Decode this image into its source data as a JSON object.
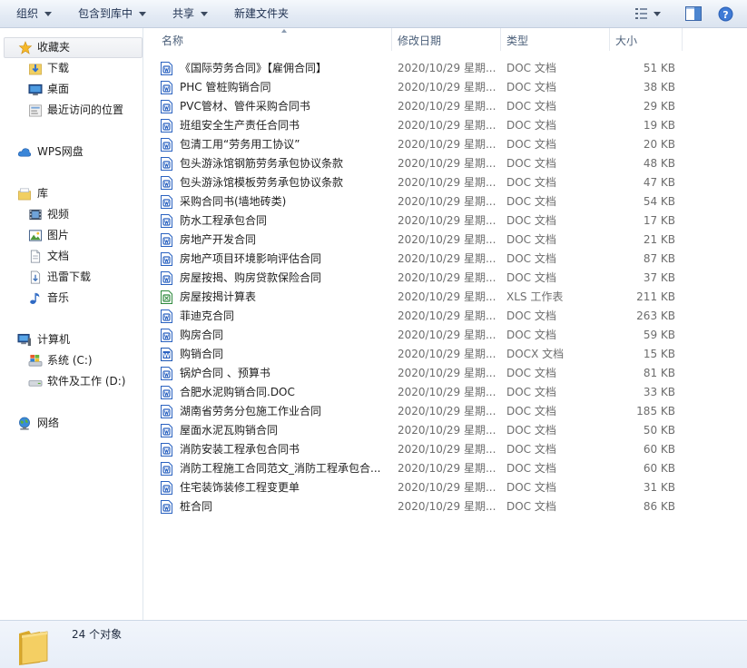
{
  "toolbar": {
    "organize": "组织",
    "include_library": "包含到库中",
    "share": "共享",
    "new_folder": "新建文件夹"
  },
  "nav": {
    "favorites": "收藏夹",
    "downloads": "下载",
    "desktop": "桌面",
    "recent": "最近访问的位置",
    "wps": "WPS网盘",
    "libraries": "库",
    "videos": "视频",
    "pictures": "图片",
    "documents": "文档",
    "xunlei": "迅雷下载",
    "music": "音乐",
    "computer": "计算机",
    "drive_c": "系统 (C:)",
    "drive_d": "软件及工作 (D:)",
    "network": "网络"
  },
  "columns": {
    "name": "名称",
    "date": "修改日期",
    "type": "类型",
    "size": "大小"
  },
  "files": [
    {
      "name": "《国际劳务合同》【雇佣合同】",
      "date": "2020/10/29 星期...",
      "type": "DOC 文档",
      "size": "51 KB",
      "icon": "doc"
    },
    {
      "name": "PHC 管桩购销合同",
      "date": "2020/10/29 星期...",
      "type": "DOC 文档",
      "size": "38 KB",
      "icon": "doc"
    },
    {
      "name": "PVC管材、管件采购合同书",
      "date": "2020/10/29 星期...",
      "type": "DOC 文档",
      "size": "29 KB",
      "icon": "doc"
    },
    {
      "name": "班组安全生产责任合同书",
      "date": "2020/10/29 星期...",
      "type": "DOC 文档",
      "size": "19 KB",
      "icon": "doc"
    },
    {
      "name": "包清工用“劳务用工协议”",
      "date": "2020/10/29 星期...",
      "type": "DOC 文档",
      "size": "20 KB",
      "icon": "doc"
    },
    {
      "name": "包头游泳馆钢筋劳务承包协议条款",
      "date": "2020/10/29 星期...",
      "type": "DOC 文档",
      "size": "48 KB",
      "icon": "doc"
    },
    {
      "name": "包头游泳馆模板劳务承包协议条款",
      "date": "2020/10/29 星期...",
      "type": "DOC 文档",
      "size": "47 KB",
      "icon": "doc"
    },
    {
      "name": "采购合同书(墙地砖类)",
      "date": "2020/10/29 星期...",
      "type": "DOC 文档",
      "size": "54 KB",
      "icon": "doc"
    },
    {
      "name": "防水工程承包合同",
      "date": "2020/10/29 星期...",
      "type": "DOC 文档",
      "size": "17 KB",
      "icon": "doc"
    },
    {
      "name": "房地产开发合同",
      "date": "2020/10/29 星期...",
      "type": "DOC 文档",
      "size": "21 KB",
      "icon": "doc"
    },
    {
      "name": "房地产项目环境影响评估合同",
      "date": "2020/10/29 星期...",
      "type": "DOC 文档",
      "size": "87 KB",
      "icon": "doc"
    },
    {
      "name": "房屋按揭、购房贷款保险合同",
      "date": "2020/10/29 星期...",
      "type": "DOC 文档",
      "size": "37 KB",
      "icon": "doc"
    },
    {
      "name": "房屋按揭计算表",
      "date": "2020/10/29 星期...",
      "type": "XLS 工作表",
      "size": "211 KB",
      "icon": "xls"
    },
    {
      "name": "菲迪克合同",
      "date": "2020/10/29 星期...",
      "type": "DOC 文档",
      "size": "263 KB",
      "icon": "doc"
    },
    {
      "name": "购房合同",
      "date": "2020/10/29 星期...",
      "type": "DOC 文档",
      "size": "59 KB",
      "icon": "doc"
    },
    {
      "name": "购销合同",
      "date": "2020/10/29 星期...",
      "type": "DOCX 文档",
      "size": "15 KB",
      "icon": "docx"
    },
    {
      "name": "锅炉合同 、预算书",
      "date": "2020/10/29 星期...",
      "type": "DOC 文档",
      "size": "81 KB",
      "icon": "doc"
    },
    {
      "name": "合肥水泥购销合同.DOC",
      "date": "2020/10/29 星期...",
      "type": "DOC 文档",
      "size": "33 KB",
      "icon": "doc"
    },
    {
      "name": "湖南省劳务分包施工作业合同",
      "date": "2020/10/29 星期...",
      "type": "DOC 文档",
      "size": "185 KB",
      "icon": "doc"
    },
    {
      "name": "屋面水泥瓦购销合同",
      "date": "2020/10/29 星期...",
      "type": "DOC 文档",
      "size": "50 KB",
      "icon": "doc"
    },
    {
      "name": "消防安装工程承包合同书",
      "date": "2020/10/29 星期...",
      "type": "DOC 文档",
      "size": "60 KB",
      "icon": "doc"
    },
    {
      "name": "消防工程施工合同范文_消防工程承包合...",
      "date": "2020/10/29 星期...",
      "type": "DOC 文档",
      "size": "60 KB",
      "icon": "doc"
    },
    {
      "name": "住宅装饰装修工程变更单",
      "date": "2020/10/29 星期...",
      "type": "DOC 文档",
      "size": "31 KB",
      "icon": "doc"
    },
    {
      "name": "桩合同",
      "date": "2020/10/29 星期...",
      "type": "DOC 文档",
      "size": "86 KB",
      "icon": "doc"
    }
  ],
  "status": {
    "count": "24 个对象"
  }
}
